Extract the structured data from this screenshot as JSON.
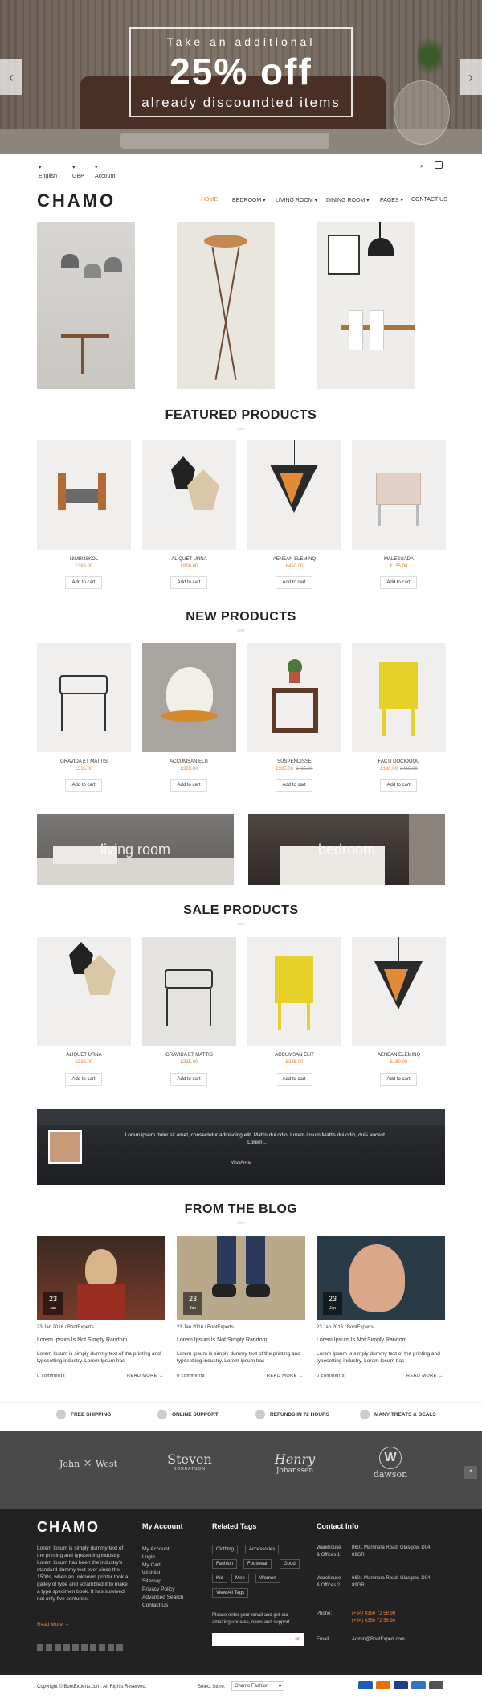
{
  "hero": {
    "line1": "Take an additional",
    "big": "25% off",
    "line3": "already discoundted items"
  },
  "topbar": {
    "language": "English",
    "currency": "GBP",
    "account": "Account"
  },
  "header": {
    "logo": "CHAMO",
    "nav": [
      {
        "label": "HOME"
      },
      {
        "label": "BEDROOM"
      },
      {
        "label": "LIVING ROOM"
      },
      {
        "label": "DINING ROOM"
      },
      {
        "label": "PAGES"
      },
      {
        "label": "CONTACT US"
      }
    ]
  },
  "featured": {
    "title": "FEATURED PRODUCTS",
    "products": [
      {
        "name": "NIMBUSKOL",
        "price": "£385.00",
        "cart": "Add to cart"
      },
      {
        "name": "ALIQUET URNA",
        "price": "£800.00",
        "cart": "Add to cart"
      },
      {
        "name": "AENEAN ELEMINQ",
        "price": "£450.00",
        "cart": "Add to cart"
      },
      {
        "name": "MALESUADA",
        "price": "£155.00",
        "cart": "Add to cart"
      }
    ]
  },
  "new_products": {
    "title": "NEW PRODUCTS",
    "products": [
      {
        "name": "GRAVIDA ET MATTIS",
        "price": "£335.00",
        "old": "",
        "cart": "Add to cart"
      },
      {
        "name": "ACCUMSAN ELIT",
        "price": "£335.00",
        "old": "",
        "cart": "Add to cart"
      },
      {
        "name": "SUSPENDISSE",
        "price": "£335.00",
        "old": "£415.00",
        "cart": "Add to cart"
      },
      {
        "name": "FACTI DOCIOGQU",
        "price": "£190.00",
        "old": "£415.00",
        "cart": "Add to cart"
      }
    ]
  },
  "banners": [
    {
      "label": "living room"
    },
    {
      "label": "bedroom"
    }
  ],
  "sale": {
    "title": "SALE PRODUCTS",
    "products": [
      {
        "name": "ALIQUET URNA",
        "price": "£335.00",
        "cart": "Add to cart"
      },
      {
        "name": "GRAVIDA ET MATTIS",
        "price": "£335.00",
        "cart": "Add to cart"
      },
      {
        "name": "ACCUMSAN ELIT",
        "price": "£335.00",
        "cart": "Add to cart"
      },
      {
        "name": "AENEAN ELEMINQ",
        "price": "£160.00",
        "cart": "Add to cart"
      }
    ]
  },
  "testimonial": {
    "quote": "Lorem ipsum dolor sit amet, consectetur adipiscing elit. Mattis dui odio, Lorem ipsum Mattis dui odio, duis aucest... Lorem...",
    "author": "MissAnna"
  },
  "blog": {
    "title": "FROM THE BLOG",
    "posts": [
      {
        "day": "23",
        "month": "Jan",
        "meta": "23 Jan 2016 / BootExperts",
        "title": "Lorem Ipsum Is Not Simply Random.",
        "text": "Lorem Ipsum is simply dummy text of the printing and typesetting industry. Lorem Ipsum has",
        "comments": "0 comments",
        "more": "READ MORE"
      },
      {
        "day": "23",
        "month": "Jan",
        "meta": "23 Jan 2016 / BootExperts",
        "title": "Lorem Ipsum Is Not Simply Random.",
        "text": "Lorem Ipsum is simply dummy text of the printing and typesetting industry. Lorem Ipsum has",
        "comments": "0 comments",
        "more": "READ MORE"
      },
      {
        "day": "23",
        "month": "Jan",
        "meta": "23 Jan 2016 / BootExperts",
        "title": "Lorem Ipsum Is Not Simply Random.",
        "text": "Lorem Ipsum is simply dummy text of the printing and typesetting industry. Lorem Ipsum has",
        "comments": "0 comments",
        "more": "READ MORE"
      }
    ]
  },
  "features": [
    {
      "label": "FREE SHIPPING"
    },
    {
      "label": "ONLINE SUPPORT"
    },
    {
      "label": "REFUNDS IN 72 HOURS"
    },
    {
      "label": "MANY TREATS & DEALS"
    }
  ],
  "brands": [
    {
      "top": "John",
      "bottom": "West"
    },
    {
      "top": "Steven",
      "bottom": "BOREATSON"
    },
    {
      "top": "Henry",
      "bottom": "Johanssen"
    },
    {
      "top": "W",
      "bottom": "dawson"
    }
  ],
  "footer": {
    "logo": "CHAMO",
    "about": "Lorem Ipsum is simply dummy text of the printing and typesetting industry. Lorem Ipsum has been the industry's standard dummy text ever since the 1500s, when an unknown printer took a galley of type and scrambled it to make a type specimen book. It has survived not only five centuries.",
    "read_more": "Read More",
    "my_account_title": "My Account",
    "my_account": [
      "My Account",
      "Login",
      "My Cart",
      "Wishlist",
      "Sitemap",
      "Privacy Policy",
      "Advanced Search",
      "Contact Us"
    ],
    "tags_title": "Related Tags",
    "tags": [
      "Clothing",
      "Accessories",
      "Fashion",
      "Footwear",
      "Good",
      "Kid",
      "Men",
      "Women",
      "View All Tags"
    ],
    "newsletter": "Please enter your email and get our amazing updates, news and support...",
    "contact_title": "Contact Info",
    "contact": [
      {
        "label": "Warehouse & Offices 1",
        "value": "8601 Marrinera Road, Glasgow, D04 89GR"
      },
      {
        "label": "Warehouse & Offices 2",
        "value": "6601 Marrinera Road, Glasgow, D04 89GR"
      },
      {
        "label": "Phone:",
        "value": "(+84) 0350 72 58 90 (+84) 0350 72 58 90"
      },
      {
        "label": "Email:",
        "value": "Admin@BootExpert.com"
      }
    ],
    "copyright": "Copyright © BootExperts.com. All Rights Reserved.",
    "select_store_label": "Select Store:",
    "select_store_value": "Chamo Fashion"
  }
}
